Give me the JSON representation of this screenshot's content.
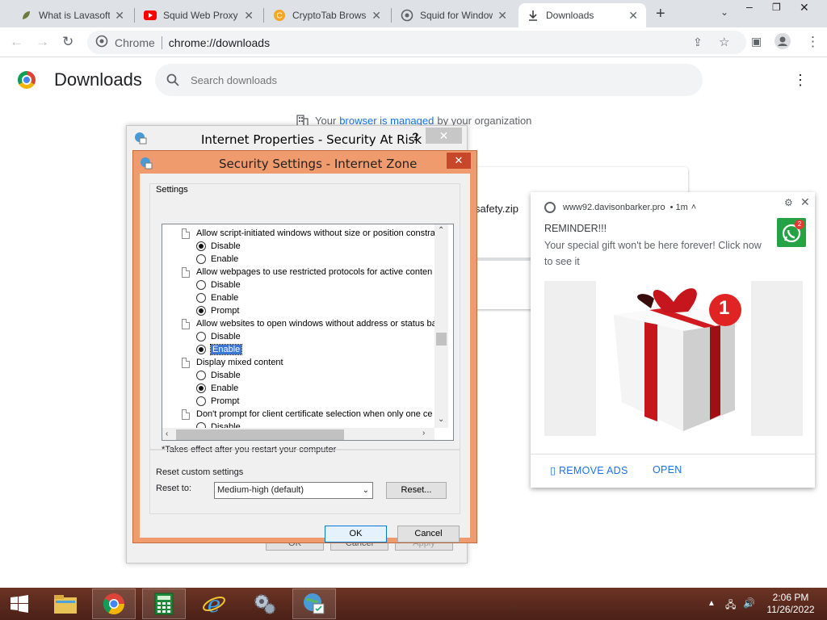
{
  "tabs": [
    {
      "title": "What is Lavasoft",
      "icon": "leaf-icon",
      "active": false
    },
    {
      "title": "Squid Web Proxy",
      "icon": "youtube-icon",
      "active": false
    },
    {
      "title": "CryptoTab Browser",
      "icon": "cryptotab-icon",
      "active": false
    },
    {
      "title": "Squid for Windows",
      "icon": "globe-icon",
      "active": false
    },
    {
      "title": "Downloads",
      "icon": "download-icon",
      "active": true
    }
  ],
  "toolbar": {
    "omnibox_chip": "Chrome",
    "url": "chrome://downloads"
  },
  "page": {
    "title": "Downloads",
    "search_placeholder": "Search downloads",
    "managed_prefix": "Your",
    "managed_link": "browser is managed",
    "managed_suffix": "by your organization",
    "download_filename_tail": "safety.zip"
  },
  "notification": {
    "origin": "www92.davisonbarker.pro",
    "time": "• 1m",
    "title": "REMINDER!!!",
    "body": "Your special gift won't be here forever! Click now to see it",
    "icon_badge": "2",
    "image_badge": "1",
    "actions": {
      "remove_ads": "REMOVE ADS",
      "open": "OPEN"
    },
    "remove_glyph": "▯"
  },
  "internet_properties": {
    "title": "Internet Properties - Security At Risk",
    "help": "?",
    "close": "✕",
    "buttons": {
      "ok": "OK",
      "cancel": "Cancel",
      "apply": "Apply"
    }
  },
  "security_settings": {
    "title": "Security Settings - Internet Zone",
    "close": "✕",
    "settings_label": "Settings",
    "tree": [
      {
        "type": "setting",
        "label": "Allow script-initiated windows without size or position constra"
      },
      {
        "type": "option",
        "label": "Disable",
        "checked": true,
        "selected": false
      },
      {
        "type": "option",
        "label": "Enable",
        "checked": false,
        "selected": false
      },
      {
        "type": "setting",
        "label": "Allow webpages to use restricted protocols for active conten"
      },
      {
        "type": "option",
        "label": "Disable",
        "checked": false,
        "selected": false
      },
      {
        "type": "option",
        "label": "Enable",
        "checked": false,
        "selected": false
      },
      {
        "type": "option",
        "label": "Prompt",
        "checked": true,
        "selected": false
      },
      {
        "type": "setting",
        "label": "Allow websites to open windows without address or status ba"
      },
      {
        "type": "option",
        "label": "Disable",
        "checked": false,
        "selected": false
      },
      {
        "type": "option",
        "label": "Enable",
        "checked": true,
        "selected": true
      },
      {
        "type": "setting",
        "label": "Display mixed content"
      },
      {
        "type": "option",
        "label": "Disable",
        "checked": false,
        "selected": false
      },
      {
        "type": "option",
        "label": "Enable",
        "checked": true,
        "selected": false
      },
      {
        "type": "option",
        "label": "Prompt",
        "checked": false,
        "selected": false
      },
      {
        "type": "setting",
        "label": "Don't prompt for client certificate selection when only one ce"
      },
      {
        "type": "option",
        "label": "Disable",
        "checked": false,
        "selected": false
      }
    ],
    "restart_note": "*Takes effect after you restart your computer",
    "reset_group_label": "Reset custom settings",
    "reset_to_label": "Reset to:",
    "reset_to_value": "Medium-high (default)",
    "reset_button": "Reset...",
    "ok": "OK",
    "cancel": "Cancel"
  },
  "taskbar": {
    "time": "2:06 PM",
    "date": "11/26/2022"
  },
  "colors": {
    "dialog_frame": "#f09b6e",
    "taskbar": "#5a2a1d",
    "link": "#1a73e8"
  }
}
